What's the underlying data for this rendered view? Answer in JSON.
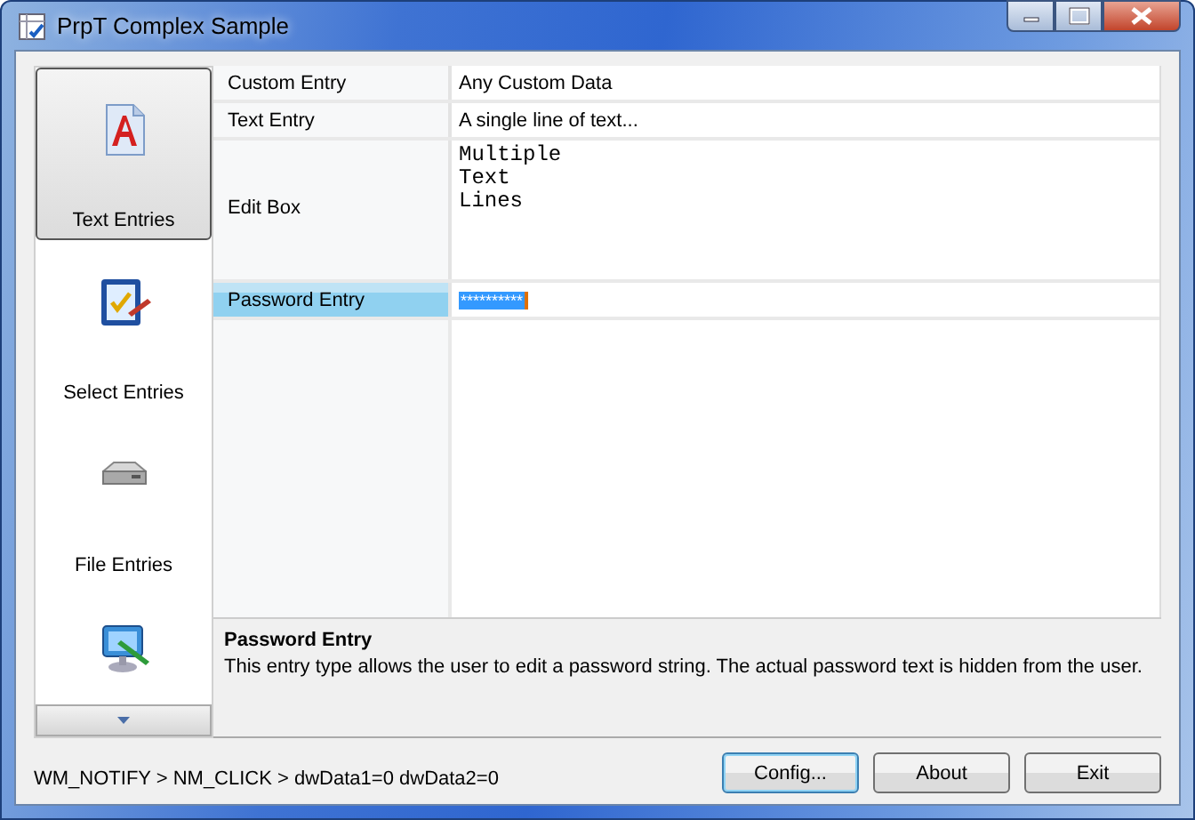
{
  "window": {
    "title": "PrpT Complex Sample"
  },
  "sidebar": {
    "items": [
      {
        "label": "Text Entries",
        "kind": "text",
        "selected": true
      },
      {
        "label": "Select Entries",
        "kind": "select",
        "selected": false
      },
      {
        "label": "File Entries",
        "kind": "file",
        "selected": false
      },
      {
        "kind": "monitor",
        "selected": false
      }
    ]
  },
  "properties": [
    {
      "name": "Custom Entry",
      "value": "Any Custom Data",
      "kind": "text",
      "selected": false
    },
    {
      "name": "Text Entry",
      "value": "A single line of text...",
      "kind": "text",
      "selected": false
    },
    {
      "name": "Edit Box",
      "value": "Multiple\nText\nLines",
      "kind": "multiline",
      "selected": false
    },
    {
      "name": "Password Entry",
      "value": "**********",
      "kind": "password",
      "selected": true
    }
  ],
  "description": {
    "title": "Password Entry",
    "text": "This entry type allows the user to edit a password string. The actual password text is hidden from the user."
  },
  "status_bar": "WM_NOTIFY > NM_CLICK > dwData1=0 dwData2=0",
  "buttons": [
    {
      "label": "Config...",
      "default": true
    },
    {
      "label": "About",
      "default": false
    },
    {
      "label": "Exit",
      "default": false
    }
  ]
}
